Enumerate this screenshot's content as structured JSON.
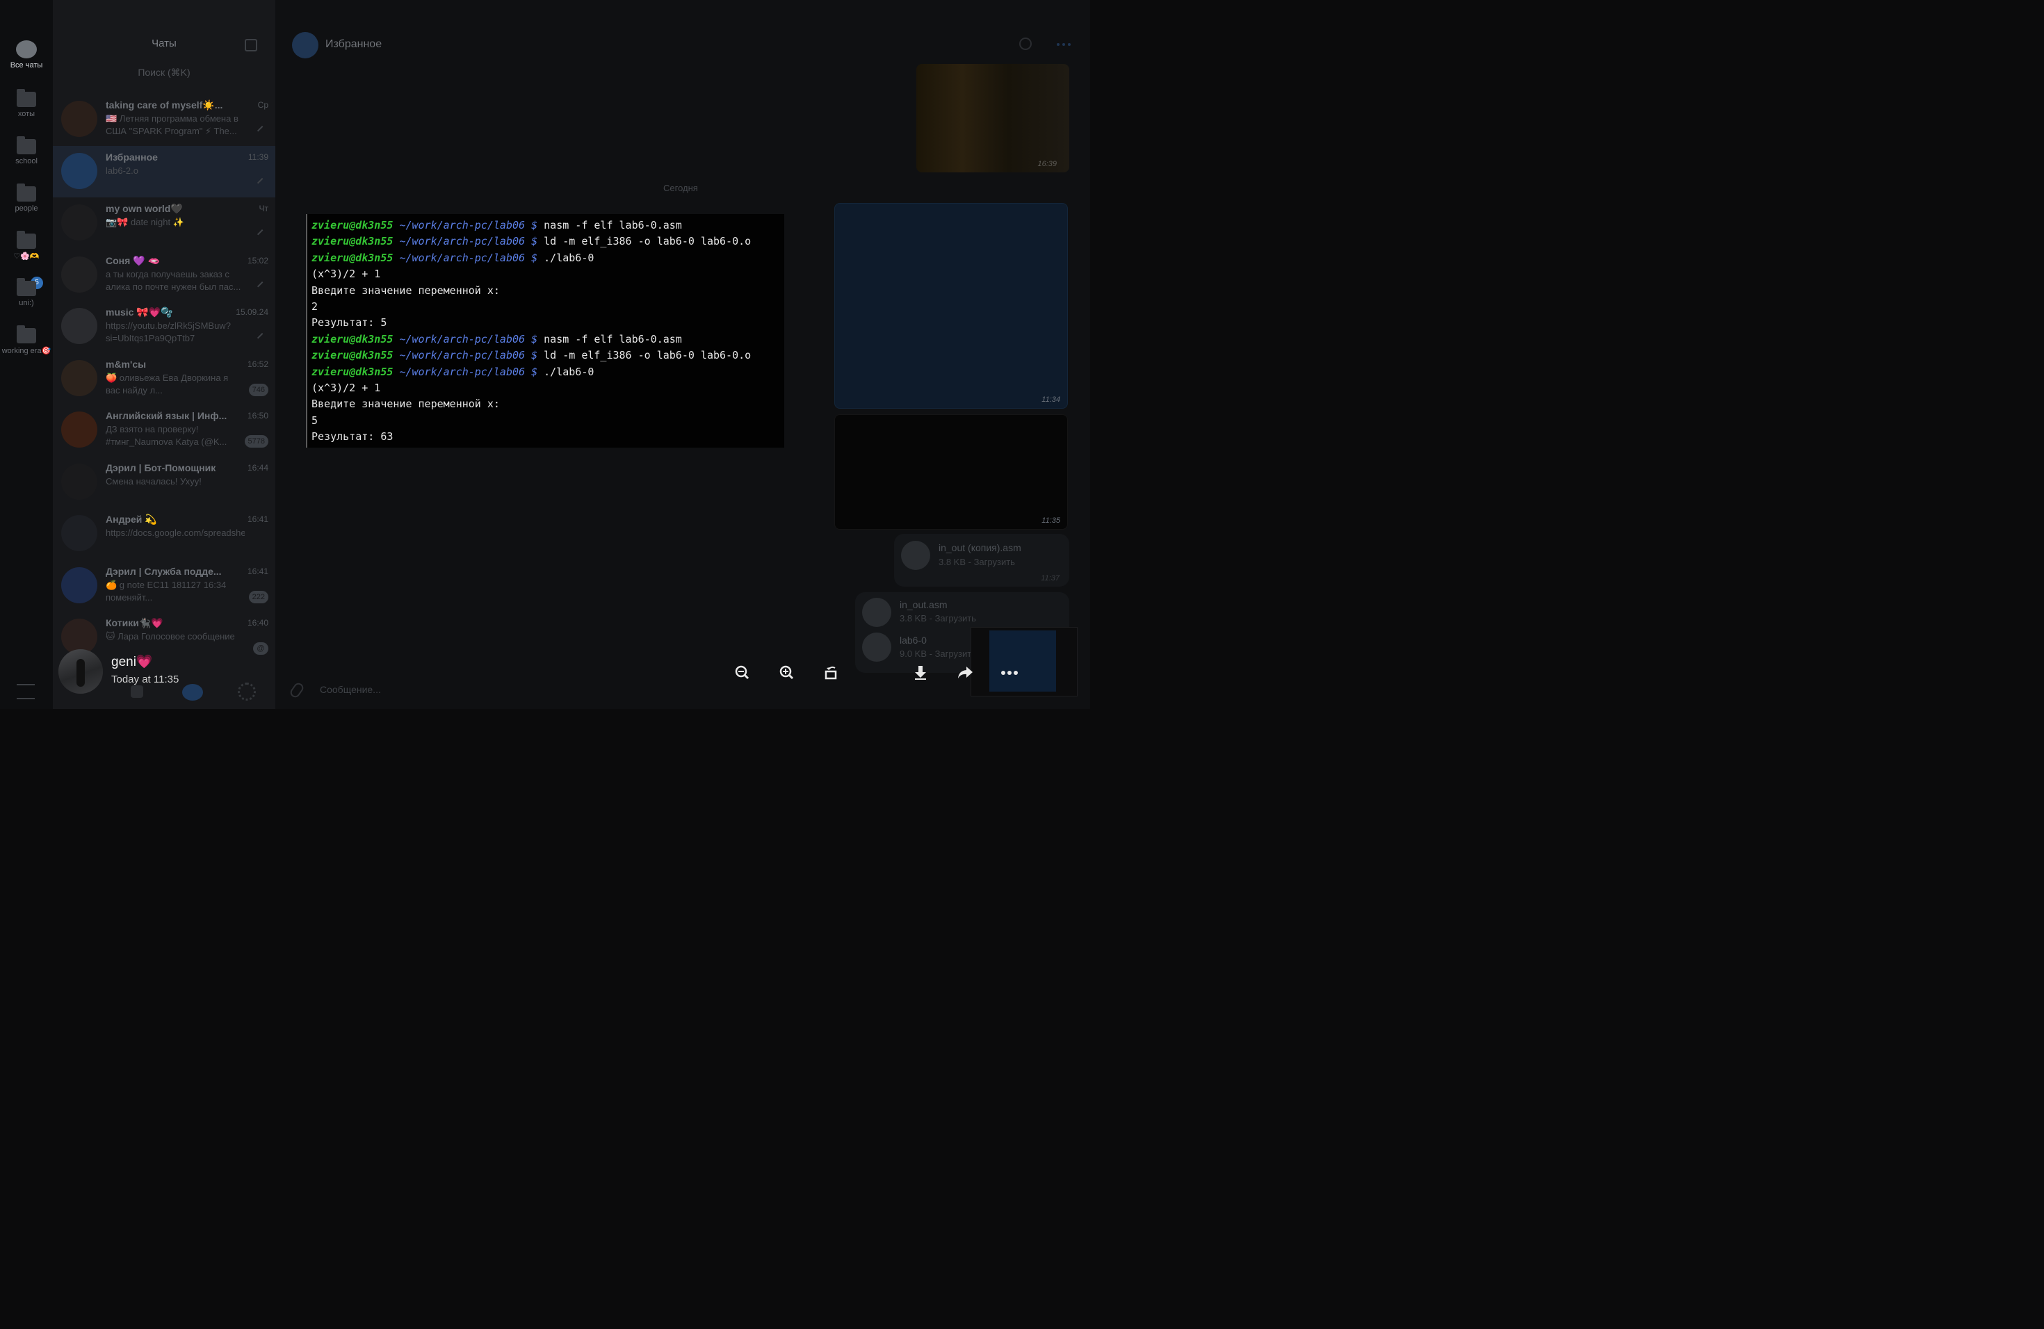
{
  "folders": {
    "items": [
      {
        "label": "Все чаты",
        "active": true
      },
      {
        "label": "хоты"
      },
      {
        "label": "school"
      },
      {
        "label": "people"
      },
      {
        "label": "♡🌸🫶"
      },
      {
        "label": "uni:)",
        "badge": "5"
      },
      {
        "label": "working era🎯"
      }
    ]
  },
  "chatlist": {
    "title": "Чаты",
    "search_placeholder": "Поиск (⌘K)",
    "chats": [
      {
        "name": "taking care of myself☀️...",
        "time": "Ср",
        "preview": "🇺🇸 Летняя программа обмена в США \"SPARK Program\" ⚡ The..."
      },
      {
        "name": "Избранное",
        "time": "11:39",
        "preview": "lab6-2.o"
      },
      {
        "name": "my own world🖤",
        "time": "Чт",
        "preview": "📷🎀 date night ✨"
      },
      {
        "name": "Соня 💜 🫦",
        "time": "15:02",
        "preview": "а ты когда получаешь заказ с алика по почте нужен был пас..."
      },
      {
        "name": "music 🎀💗🫧",
        "time": "15.09.24",
        "preview": "https://youtu.be/zlRk5jSMBuw?si=UbItqs1Pa9QpTtb7"
      },
      {
        "name": "m&m'сы",
        "time": "16:52",
        "preview": "🍑 оливьежа Ева Дворкина я вас найду л...",
        "badge": "746"
      },
      {
        "name": "Английский язык | Инф...",
        "time": "16:50",
        "preview": "ДЗ взято на проверку! #тмнг_Naumova Katya (@K...",
        "badge": "5778"
      },
      {
        "name": "Дэрил | Бот-Помощник",
        "time": "16:44",
        "preview": "Смена началась! Ухуу!"
      },
      {
        "name": "Андрей 💫",
        "time": "16:41",
        "preview": "https://docs.google.com/spreadsheets/d/1y1ChgBkcEoh_kh..."
      },
      {
        "name": "Дэрил | Служба подде...",
        "time": "16:41",
        "preview": "🍊 g note ЕС11 181127 16:34 поменяйт...",
        "badge": "222"
      },
      {
        "name": "Котики🐈‍⬛💗",
        "time": "16:40",
        "preview": "🐱 Лара Голосовое сообщение",
        "badge": "@"
      }
    ]
  },
  "chat": {
    "title": "Избранное",
    "date_divider": "Сегодня",
    "input_placeholder": "Сообщение...",
    "msg_times": [
      "16:39",
      "11:34",
      "11:35",
      "11:37"
    ],
    "files": [
      {
        "name": "in_out (копия).asm",
        "size": "3.8 KB - Загрузить"
      },
      {
        "name": "in_out.asm",
        "size": "3.8 KB - Загрузить"
      },
      {
        "name": "lab6-0",
        "size": "9.0 KB - Загрузить"
      }
    ]
  },
  "terminal": {
    "prompt_user": "zvieru@dk3n55",
    "prompt_path": "~/work/arch-pc/lab06",
    "prompt_sign": "$",
    "lines": [
      {
        "kind": "cmd",
        "text": "nasm -f elf lab6-0.asm"
      },
      {
        "kind": "cmd",
        "text": "ld -m elf_i386 -o lab6-0 lab6-0.o"
      },
      {
        "kind": "cmd",
        "text": "./lab6-0"
      },
      {
        "kind": "out",
        "text": "(x^3)/2 + 1"
      },
      {
        "kind": "out",
        "text": "Введите значение переменной х:"
      },
      {
        "kind": "out",
        "text": "2"
      },
      {
        "kind": "out",
        "text": "Результат: 5"
      },
      {
        "kind": "cmd",
        "text": "nasm -f elf lab6-0.asm"
      },
      {
        "kind": "cmd",
        "text": "ld -m elf_i386 -o lab6-0 lab6-0.o"
      },
      {
        "kind": "cmd",
        "text": "./lab6-0"
      },
      {
        "kind": "out",
        "text": "(x^3)/2 + 1"
      },
      {
        "kind": "out",
        "text": "Введите значение переменной х:"
      },
      {
        "kind": "out",
        "text": "5"
      },
      {
        "kind": "out",
        "text": "Результат: 63"
      }
    ]
  },
  "viewer": {
    "sender_name": "geni💗",
    "sent_date": "Today at 11:35",
    "toolbar": [
      "zoom-out-icon",
      "zoom-in-icon",
      "rotate-icon",
      "download-icon",
      "forward-icon",
      "more-icon"
    ]
  }
}
